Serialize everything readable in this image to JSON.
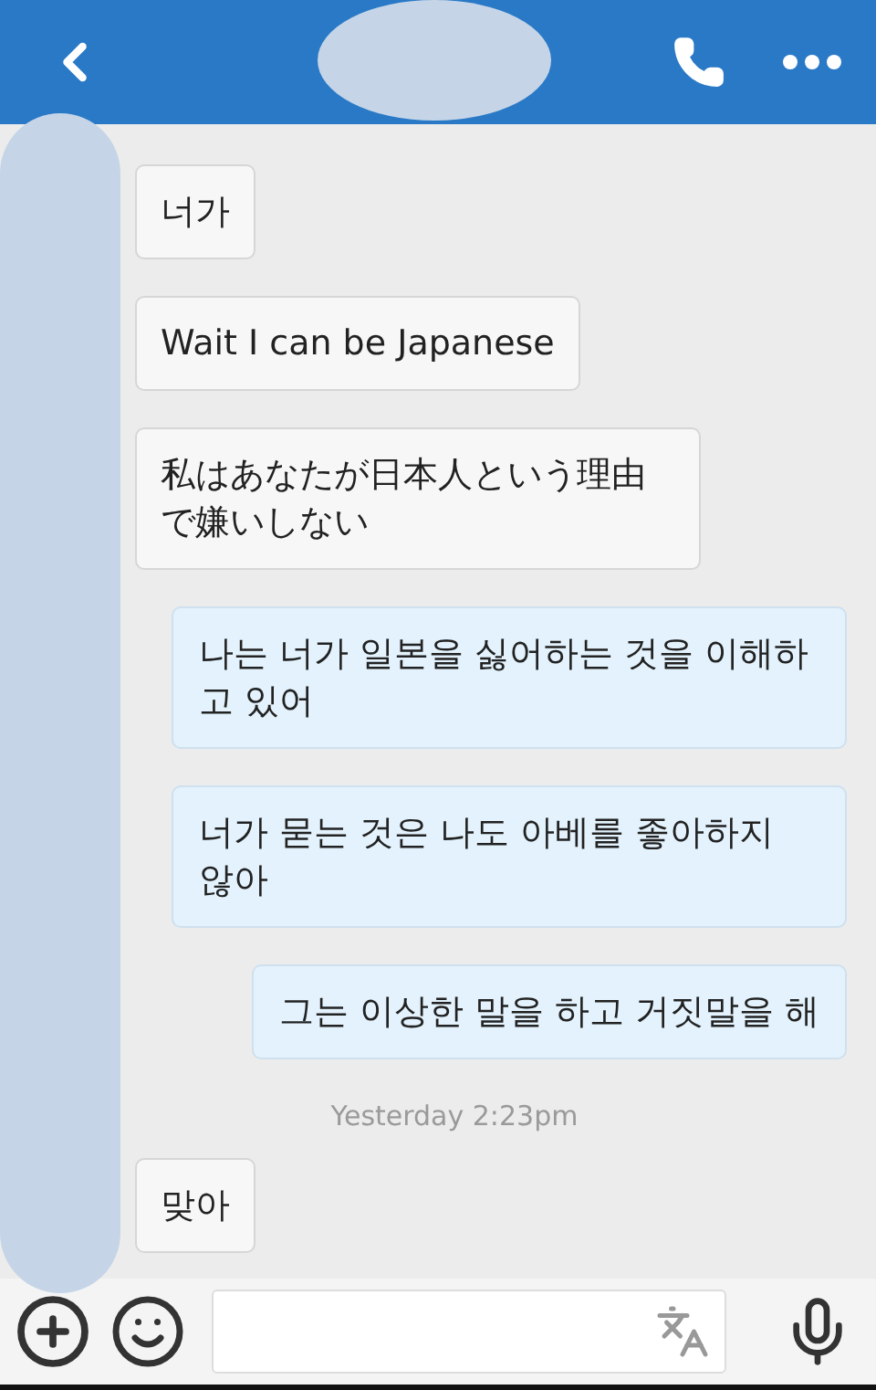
{
  "messages": [
    {
      "kind": "in",
      "text": "너가"
    },
    {
      "kind": "in",
      "text": "Wait I can be Japanese"
    },
    {
      "kind": "in",
      "text": "私はあなたが日本人という理由で嫌いしない"
    },
    {
      "kind": "out",
      "text": "나는 너가 일본을 싫어하는 것을 이해하고 있어"
    },
    {
      "kind": "out",
      "text": "너가 묻는 것은 나도 아베를 좋아하지 않아"
    },
    {
      "kind": "out",
      "text": "그는 이상한 말을 하고 거짓말을 해"
    },
    {
      "kind": "time",
      "text": "Yesterday 2:23pm"
    },
    {
      "kind": "in",
      "text": "맞아"
    }
  ]
}
